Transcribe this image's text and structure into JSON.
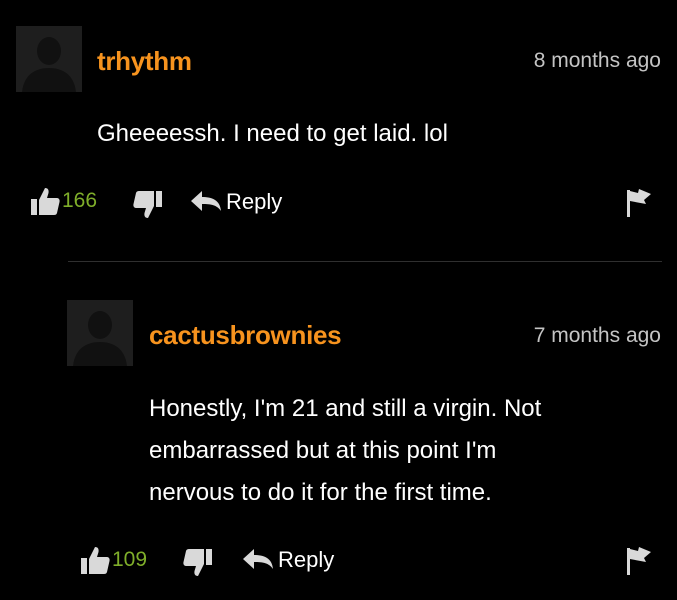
{
  "comments": [
    {
      "username": "trhythm",
      "timestamp": "8 months ago",
      "text": "Gheeeessh. I need to get laid. lol",
      "upvotes": "166",
      "reply_label": "Reply",
      "avatar_icon": "default-user-silhouette-icon"
    },
    {
      "username": "cactusbrownies",
      "timestamp": "7 months ago",
      "text_lines": [
        "Honestly, I'm 21 and still a virgin. Not",
        "embarrassed but at this point I'm",
        "nervous to do it for the first time."
      ],
      "upvotes": "109",
      "reply_label": "Reply",
      "avatar_icon": "default-user-silhouette-icon"
    }
  ],
  "colors": {
    "background": "#000000",
    "username": "#f7931e",
    "upvote_count": "#7fae2a",
    "timestamp": "#c4c4c4",
    "text": "#ffffff",
    "icon": "#d9d9d9",
    "divider": "#2f2f2f"
  },
  "icons": {
    "thumbs_up": "thumbs-up-icon",
    "thumbs_down": "thumbs-down-icon",
    "reply": "reply-arrow-icon",
    "flag": "flag-icon"
  }
}
